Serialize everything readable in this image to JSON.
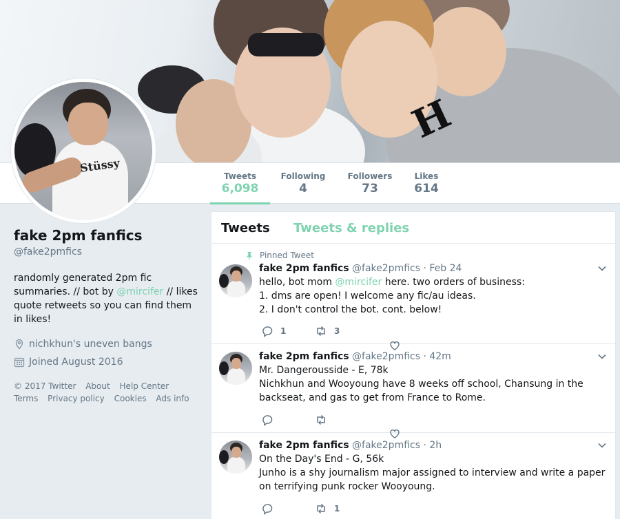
{
  "profile": {
    "name": "fake 2pm fanfics",
    "handle": "@fake2pmfics",
    "bio_pre": "randomly generated 2pm fic summaries. // bot by ",
    "bio_link": "@mircifer",
    "bio_post": " // likes quote retweets so you can find them in likes!",
    "location": "nichkhun's uneven bangs",
    "joined": "Joined August 2016"
  },
  "nav": {
    "stats": [
      {
        "label": "Tweets",
        "value": "6,098"
      },
      {
        "label": "Following",
        "value": "4"
      },
      {
        "label": "Followers",
        "value": "73"
      },
      {
        "label": "Likes",
        "value": "614"
      }
    ]
  },
  "footer": {
    "links": [
      "© 2017 Twitter",
      "About",
      "Help Center",
      "Terms",
      "Privacy policy",
      "Cookies",
      "Ads info"
    ]
  },
  "timeline": {
    "tabs": [
      "Tweets",
      "Tweets & replies"
    ],
    "pinned_label": "Pinned Tweet",
    "tweets": [
      {
        "name": "fake 2pm fanfics",
        "meta": "@fake2pmfics · Feb 24",
        "line1_pre": "hello, bot mom ",
        "line1_link": "@mircifer",
        "line1_post": " here. two orders of business:",
        "line2": "1. dms are open! I welcome any fic/au ideas.",
        "line3": "2. I don't control the bot. cont. below!",
        "replies": "1",
        "retweets": "3"
      },
      {
        "name": "fake 2pm fanfics",
        "meta": "@fake2pmfics · 42m",
        "line1": "Mr. Dangerousside - E, 78k",
        "line2": "Nichkhun and Wooyoung have 8 weeks off school, Chansung in the backseat, and gas to get from France to Rome.",
        "replies": "",
        "retweets": ""
      },
      {
        "name": "fake 2pm fanfics",
        "meta": "@fake2pmfics · 2h",
        "line1": "On the Day's End - G, 56k",
        "line2": "Junho is a shy journalism major assigned to interview and write a paper on terrifying punk rocker Wooyoung.",
        "replies": "",
        "retweets": "1"
      }
    ]
  },
  "colors": {
    "accent": "#7ed3b0",
    "muted": "#657786",
    "bg": "#e6ecf0"
  },
  "icons": [
    "location-pin-icon",
    "calendar-icon",
    "pin-icon",
    "reply-icon",
    "retweet-icon",
    "heart-icon",
    "chevron-down-icon"
  ]
}
